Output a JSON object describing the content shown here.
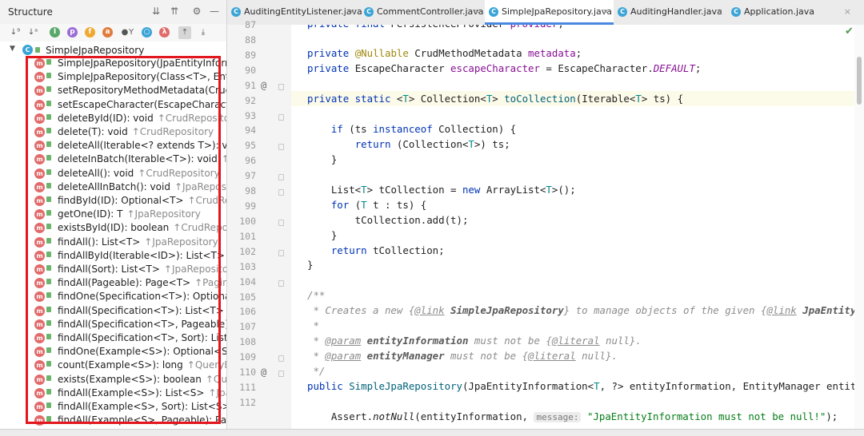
{
  "panel": {
    "title": "Structure",
    "root_label": "SimpleJpaRepository",
    "methods": [
      {
        "label": "SimpleJpaRepository(JpaEntityInform",
        "suffix": ""
      },
      {
        "label": "SimpleJpaRepository(Class<T>, Entity",
        "suffix": ""
      },
      {
        "label": "setRepositoryMethodMetadata(CrudM",
        "suffix": ""
      },
      {
        "label": "setEscapeCharacter(EscapeCharacter",
        "suffix": ""
      },
      {
        "label": "deleteById(ID): void",
        "suffix": "↑CrudRepository"
      },
      {
        "label": "delete(T): void",
        "suffix": "↑CrudRepository"
      },
      {
        "label": "deleteAll(Iterable<? extends T>): void",
        "suffix": ""
      },
      {
        "label": "deleteInBatch(Iterable<T>): void",
        "suffix": "↑Jpa"
      },
      {
        "label": "deleteAll(): void",
        "suffix": "↑CrudRepository"
      },
      {
        "label": "deleteAllInBatch(): void",
        "suffix": "↑JpaReposito"
      },
      {
        "label": "findById(ID): Optional<T>",
        "suffix": "↑CrudRepo"
      },
      {
        "label": "getOne(ID): T",
        "suffix": "↑JpaRepository"
      },
      {
        "label": "existsById(ID): boolean",
        "suffix": "↑CrudReposit"
      },
      {
        "label": "findAll(): List<T>",
        "suffix": "↑JpaRepository"
      },
      {
        "label": "findAllById(Iterable<ID>): List<T>",
        "suffix": "↑Jp"
      },
      {
        "label": "findAll(Sort): List<T>",
        "suffix": "↑JpaRepository"
      },
      {
        "label": "findAll(Pageable): Page<T>",
        "suffix": "↑PagingA"
      },
      {
        "label": "findOne(Specification<T>): Optional<",
        "suffix": ""
      },
      {
        "label": "findAll(Specification<T>): List<T>",
        "suffix": "↑"
      },
      {
        "label": "findAll(Specification<T>, Pageable): P",
        "suffix": ""
      },
      {
        "label": "findAll(Specification<T>, Sort): List<T",
        "suffix": ""
      },
      {
        "label": "findOne(Example<S>): Optional<S>",
        "suffix": "↑"
      },
      {
        "label": "count(Example<S>): long",
        "suffix": "↑QueryByEx"
      },
      {
        "label": "exists(Example<S>): boolean",
        "suffix": "↑QueryB"
      },
      {
        "label": "findAll(Example<S>): List<S>",
        "suffix": "↑JpaRe"
      },
      {
        "label": "findAll(Example<S>, Sort): List<S>",
        "suffix": "↑J"
      },
      {
        "label": "findAll(Example<S>, Pageable): Page<",
        "suffix": ""
      }
    ]
  },
  "tabs": [
    {
      "label": "AuditingEntityListener.java",
      "active": false
    },
    {
      "label": "CommentController.java",
      "active": false
    },
    {
      "label": "SimpleJpaRepository.java",
      "active": true
    },
    {
      "label": "AuditingHandler.java",
      "active": false
    },
    {
      "label": "Application.java",
      "active": false
    }
  ],
  "editor": {
    "line_numbers": [
      "87",
      "88",
      "89",
      "90",
      "91",
      "92",
      "93",
      "94",
      "95",
      "96",
      "97",
      "98",
      "99",
      "100",
      "101",
      "102",
      "103",
      "104",
      "105",
      "106",
      "107",
      "108",
      "109",
      "110",
      "111",
      "112"
    ],
    "hint_message": "message:",
    "code_line_87": "private final PersistenceProvider provider;"
  },
  "colors": {
    "highlight_box": "#e3161d",
    "active_tab_underline": "#4a88e0",
    "method_icon": "#e26a6a",
    "class_icon": "#3aa4d6"
  }
}
